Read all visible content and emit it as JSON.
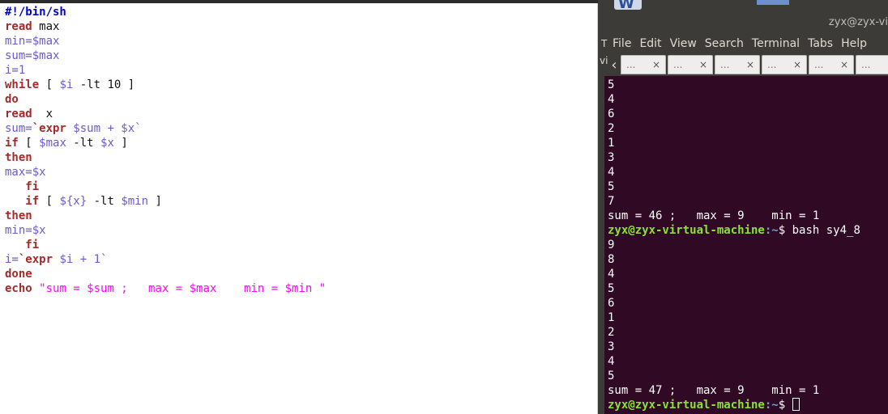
{
  "editor": {
    "lines": [
      [
        {
          "t": "#!/bin/sh",
          "c": "sb"
        }
      ],
      [
        {
          "t": "read",
          "c": "kw"
        },
        {
          "t": " max",
          "c": ""
        }
      ],
      [
        {
          "t": "min=$max",
          "c": "var"
        }
      ],
      [
        {
          "t": "sum=$max",
          "c": "var"
        }
      ],
      [
        {
          "t": "i=1",
          "c": "var"
        }
      ],
      [
        {
          "t": "while",
          "c": "kw"
        },
        {
          "t": " [ ",
          "c": ""
        },
        {
          "t": "$i",
          "c": "var"
        },
        {
          "t": " -lt 10 ]",
          "c": ""
        }
      ],
      [
        {
          "t": "do",
          "c": "kw"
        }
      ],
      [
        {
          "t": "read",
          "c": "kw"
        },
        {
          "t": "  x",
          "c": ""
        }
      ],
      [
        {
          "t": "sum=",
          "c": "var"
        },
        {
          "t": "`expr",
          "c": "kw"
        },
        {
          "t": " $sum + $x`",
          "c": "var"
        }
      ],
      [
        {
          "t": "if",
          "c": "kw"
        },
        {
          "t": " [ ",
          "c": ""
        },
        {
          "t": "$max",
          "c": "var"
        },
        {
          "t": " -lt ",
          "c": ""
        },
        {
          "t": "$x",
          "c": "var"
        },
        {
          "t": " ]",
          "c": ""
        }
      ],
      [
        {
          "t": "then",
          "c": "kw"
        }
      ],
      [
        {
          "t": "max=$x",
          "c": "var"
        }
      ],
      [
        {
          "t": "   fi",
          "c": "kw"
        }
      ],
      [
        {
          "t": "   if",
          "c": "kw"
        },
        {
          "t": " [ ",
          "c": ""
        },
        {
          "t": "${x}",
          "c": "var"
        },
        {
          "t": " -lt ",
          "c": ""
        },
        {
          "t": "$min",
          "c": "var"
        },
        {
          "t": " ]",
          "c": ""
        }
      ],
      [
        {
          "t": "then",
          "c": "kw"
        }
      ],
      [
        {
          "t": "min=$x",
          "c": "var"
        }
      ],
      [
        {
          "t": "   fi",
          "c": "kw"
        }
      ],
      [
        {
          "t": "i=",
          "c": "var"
        },
        {
          "t": "`expr",
          "c": "kw"
        },
        {
          "t": " $i + 1`",
          "c": "var"
        }
      ],
      [
        {
          "t": "done",
          "c": "kw"
        }
      ],
      [
        {
          "t": "echo",
          "c": "kw"
        },
        {
          "t": " ",
          "c": ""
        },
        {
          "t": "\"sum = $sum ;   max = $max    min = $min \"",
          "c": "str"
        }
      ]
    ]
  },
  "desktop": {
    "icon_letter": "W"
  },
  "terminal_window": {
    "title": "zyx@zyx-vi",
    "menu_cut": "T",
    "menu": [
      "File",
      "Edit",
      "View",
      "Search",
      "Terminal",
      "Tabs",
      "Help"
    ],
    "tab_cut": "vi",
    "tab_scroll_icon": "chevron-left-icon",
    "tabs": [
      {
        "label": "...",
        "close": "×"
      },
      {
        "label": "...",
        "close": "×"
      },
      {
        "label": "...",
        "close": "×"
      },
      {
        "label": "...",
        "close": "×"
      },
      {
        "label": "...",
        "close": "×"
      },
      {
        "label": "...",
        "close": "×"
      }
    ],
    "output": [
      {
        "text": "5"
      },
      {
        "text": "4"
      },
      {
        "text": "6"
      },
      {
        "text": "2"
      },
      {
        "text": "1"
      },
      {
        "text": "3"
      },
      {
        "text": "4"
      },
      {
        "text": "5"
      },
      {
        "text": "7"
      },
      {
        "text": "sum = 46 ;   max = 9    min = 1"
      },
      {
        "prompt_user": "zyx@zyx-virtual-machine",
        "prompt_path": ":~",
        "cmd": "$ bash sy4_8"
      },
      {
        "text": "9"
      },
      {
        "text": "8"
      },
      {
        "text": "4"
      },
      {
        "text": "5"
      },
      {
        "text": "6"
      },
      {
        "text": "1"
      },
      {
        "text": "2"
      },
      {
        "text": "3"
      },
      {
        "text": "4"
      },
      {
        "text": "5"
      },
      {
        "text": "sum = 47 ;   max = 9    min = 1"
      },
      {
        "prompt_user": "zyx@zyx-virtual-machine",
        "prompt_path": ":~",
        "cmd": "$ ",
        "cursor": true
      }
    ]
  },
  "colors": {
    "terminal_bg": "#300a24",
    "prompt_user": "#8ae234",
    "prompt_path": "#729fcf",
    "keyword": "#a52a2a",
    "variable": "#6a5acd",
    "string": "#ff00ff",
    "shebang": "#0000cc"
  }
}
